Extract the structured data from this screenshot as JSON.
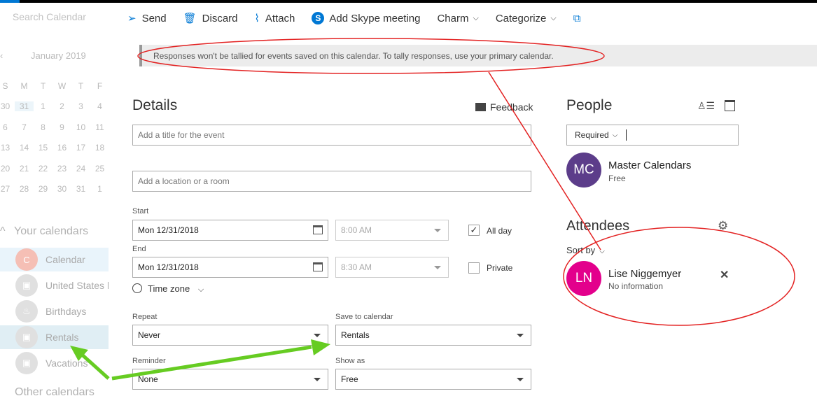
{
  "search": {
    "placeholder": "Search Calendar",
    "icon": "search-icon"
  },
  "calendar_nav": {
    "month": "January 2019",
    "weekdays": [
      "S",
      "M",
      "T",
      "W",
      "T",
      "F"
    ],
    "weeks": [
      [
        "30",
        "31",
        "1",
        "2",
        "3",
        "4"
      ],
      [
        "6",
        "7",
        "8",
        "9",
        "10",
        "11"
      ],
      [
        "13",
        "14",
        "15",
        "16",
        "17",
        "18"
      ],
      [
        "20",
        "21",
        "22",
        "23",
        "24",
        "25"
      ],
      [
        "27",
        "28",
        "29",
        "30",
        "31",
        "1"
      ]
    ]
  },
  "sidebar": {
    "your_calendars": "Your calendars",
    "other_calendars": "Other calendars",
    "items": [
      {
        "label": "Calendar",
        "initial": "C"
      },
      {
        "label": "United States h"
      },
      {
        "label": "Birthdays"
      },
      {
        "label": "Rentals"
      },
      {
        "label": "Vacations"
      }
    ]
  },
  "toolbar": {
    "send": "Send",
    "discard": "Discard",
    "attach": "Attach",
    "skype": "Add Skype meeting",
    "charm": "Charm",
    "categorize": "Categorize"
  },
  "banner": {
    "text": "Responses won't be tallied for events saved on this calendar. To tally responses, use your primary calendar."
  },
  "details": {
    "heading": "Details",
    "feedback": "Feedback",
    "title_placeholder": "Add a title for the event",
    "location_placeholder": "Add a location or a room",
    "start_label": "Start",
    "start_date": "Mon 12/31/2018",
    "start_time": "8:00 AM",
    "end_label": "End",
    "end_date": "Mon 12/31/2018",
    "end_time": "8:30 AM",
    "all_day_label": "All day",
    "all_day_checked": true,
    "private_label": "Private",
    "private_checked": false,
    "time_zone": "Time zone",
    "repeat_label": "Repeat",
    "repeat_value": "Never",
    "save_to_label": "Save to calendar",
    "save_to_value": "Rentals",
    "reminder_label": "Reminder",
    "reminder_value": "None",
    "show_as_label": "Show as",
    "show_as_value": "Free"
  },
  "people": {
    "heading": "People",
    "required": "Required",
    "organizer": {
      "initials": "MC",
      "name": "Master Calendars",
      "status": "Free",
      "color": "#5c3d8a"
    },
    "attendees_heading": "Attendees",
    "sort_by": "Sort by",
    "attendees": [
      {
        "initials": "LN",
        "name": "Lise Niggemyer",
        "status": "No information",
        "color": "#e3008c"
      }
    ]
  }
}
